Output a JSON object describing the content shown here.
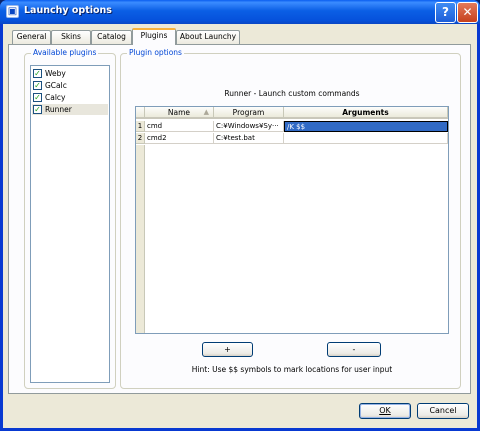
{
  "window": {
    "title": "Launchy options",
    "help_icon": "question-icon",
    "close_icon": "close-icon"
  },
  "tabs": [
    {
      "label": "General",
      "active": false
    },
    {
      "label": "Skins",
      "active": false
    },
    {
      "label": "Catalog",
      "active": false
    },
    {
      "label": "Plugins",
      "active": true
    },
    {
      "label": "About Launchy",
      "active": false
    }
  ],
  "available_plugins": {
    "label": "Available plugins",
    "items": [
      {
        "label": "Weby",
        "checked": true,
        "selected": false
      },
      {
        "label": "GCalc",
        "checked": true,
        "selected": false
      },
      {
        "label": "Calcy",
        "checked": true,
        "selected": false
      },
      {
        "label": "Runner",
        "checked": true,
        "selected": true
      }
    ]
  },
  "plugin_options": {
    "label": "Plugin options",
    "runner_title": "Runner - Launch custom commands",
    "columns": [
      "Name",
      "Program",
      "Arguments"
    ],
    "rows": [
      {
        "num": "1",
        "name": "cmd",
        "program": "C:¥Windows¥Sy···",
        "arguments": "/K $$"
      },
      {
        "num": "2",
        "name": "cmd2",
        "program": "C:¥test.bat",
        "arguments": ""
      }
    ],
    "add_label": "+",
    "remove_label": "-",
    "hint": "Hint: Use $$ symbols to mark locations for user input"
  },
  "footer": {
    "ok_label": "OK",
    "cancel_label": "Cancel"
  },
  "colors": {
    "titlebar": "#0a5ef0",
    "group_label": "#0046d5",
    "selection": "#316ac5",
    "tab_active_accent": "#f7b23d"
  }
}
